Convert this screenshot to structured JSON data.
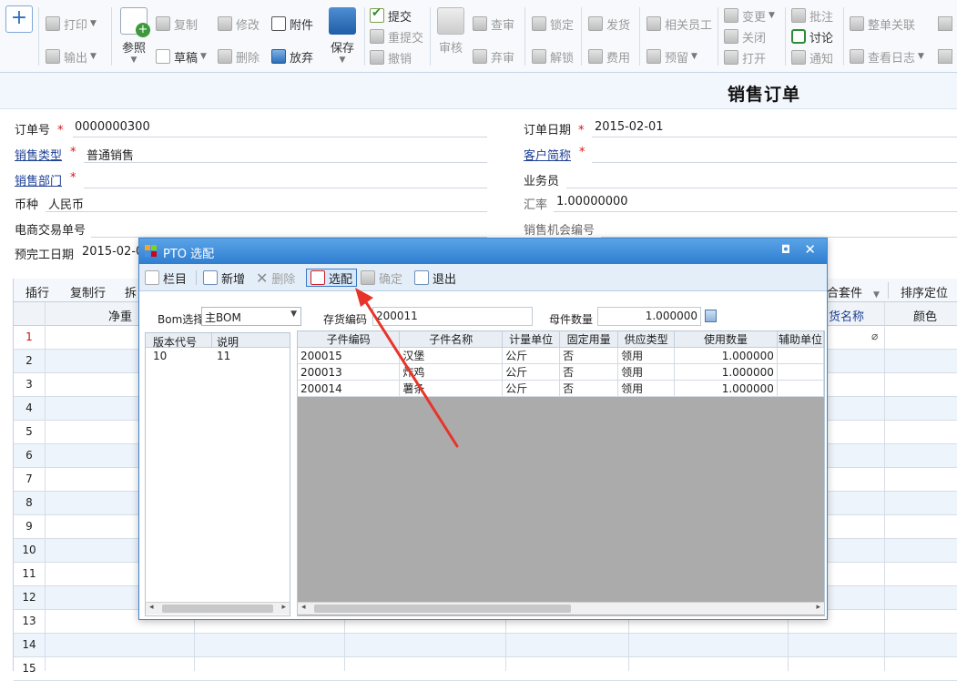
{
  "ribbon": {
    "new_icon": "+",
    "print": "打印",
    "export": "输出",
    "ref": "参照",
    "copy": "复制",
    "draft": "草稿",
    "edit": "修改",
    "delete": "删除",
    "attach": "附件",
    "abandon": "放弃",
    "save": "保存",
    "submit": "提交",
    "resubmit": "重提交",
    "revoke": "撤销",
    "audit": "审核",
    "review": "查审",
    "discard": "弃审",
    "lock": "锁定",
    "unlock": "解锁",
    "ship": "发货",
    "fee": "费用",
    "related_staff": "相关员工",
    "reserve": "预留",
    "change": "变更",
    "close": "关闭",
    "open": "打开",
    "annotate": "批注",
    "discuss": "讨论",
    "notify": "通知",
    "whole_link": "整单关联",
    "view_log": "查看日志"
  },
  "page": {
    "title": "销售订单"
  },
  "form": {
    "order_no_label": "订单号",
    "order_no": "0000000300",
    "order_date_label": "订单日期",
    "order_date": "2015-02-01",
    "sale_type_label": "销售类型",
    "sale_type": "普通销售",
    "customer_label": "客户简称",
    "dept_label": "销售部门",
    "salesman_label": "业务员",
    "currency_label": "币种",
    "currency": "人民币",
    "rate_label": "汇率",
    "rate": "1.00000000",
    "ecom_label": "电商交易单号",
    "opportunity_label": "销售机会编号",
    "finish_label": "预完工日期",
    "finish_date": "2015-02-0",
    "required_mark": "*"
  },
  "grid": {
    "toolbar": {
      "insert": "插行",
      "copy_row": "复制行",
      "split": "拆",
      "set": "合套件",
      "sort": "排序定位"
    },
    "headers": {
      "weight": "净重",
      "name": "货名称",
      "color": "颜色"
    },
    "rows": [
      "1",
      "2",
      "3",
      "4",
      "5",
      "6",
      "7",
      "8",
      "9",
      "10",
      "11",
      "12",
      "13",
      "14",
      "15"
    ]
  },
  "dialog": {
    "title": "PTO 选配",
    "toolbar": {
      "columns": "栏目",
      "add": "新增",
      "delete": "删除",
      "select": "选配",
      "confirm": "确定",
      "exit": "退出"
    },
    "bom_label": "Bom选择",
    "bom_value": "主BOM",
    "inv_label": "存货编码",
    "inv_value": "200011",
    "qty_label": "母件数量",
    "qty_value": "1.000000",
    "version_cols": [
      "版本代号",
      "说明"
    ],
    "version_rows": [
      [
        "10",
        "11"
      ]
    ],
    "comp_cols": [
      "子件编码",
      "子件名称",
      "计量单位",
      "固定用量",
      "供应类型",
      "使用数量",
      "辅助单位"
    ],
    "comp_rows": [
      [
        "200015",
        "汉堡",
        "公斤",
        "否",
        "领用",
        "1.000000",
        ""
      ],
      [
        "200013",
        "炸鸡",
        "公斤",
        "否",
        "领用",
        "1.000000",
        ""
      ],
      [
        "200014",
        "薯条",
        "公斤",
        "否",
        "领用",
        "1.000000",
        ""
      ]
    ]
  },
  "colors": {
    "accent": "#2f7ed0",
    "required": "#d11111",
    "arrow": "#e8332a"
  }
}
